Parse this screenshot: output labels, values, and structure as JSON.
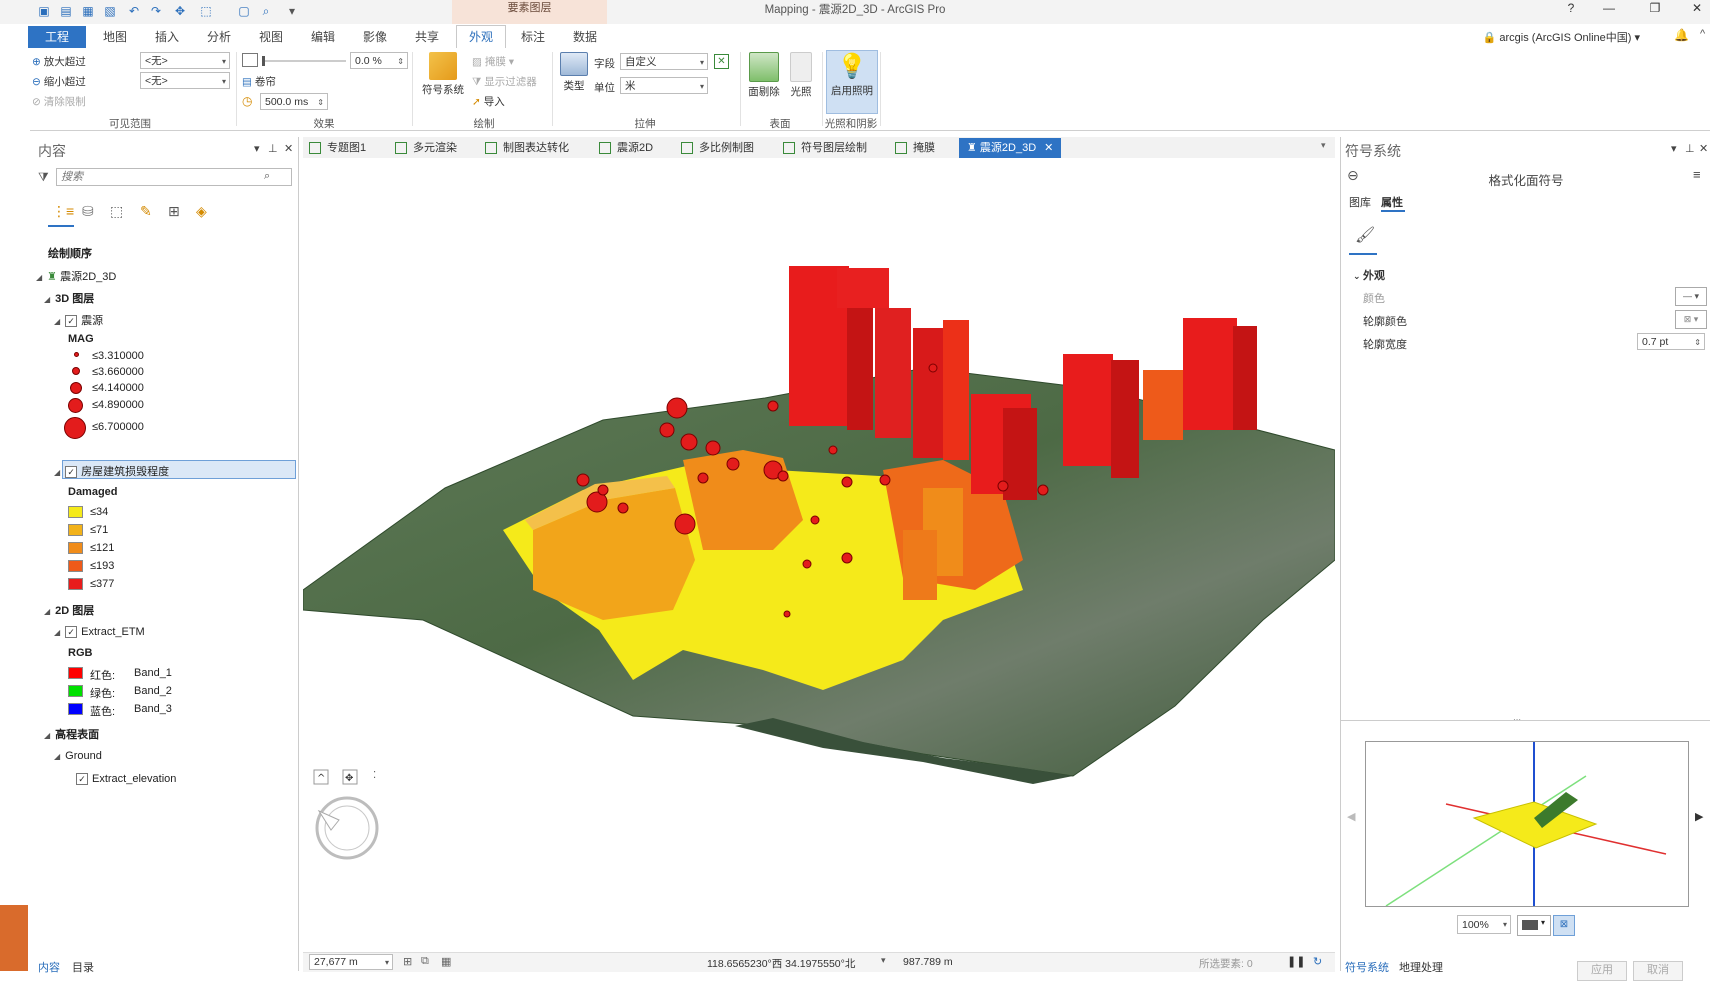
{
  "title_bar": {
    "app_title": "Mapping - 震源2D_3D - ArcGIS Pro",
    "context_tab_group": "要素图层",
    "help": "?",
    "minimize": "—",
    "restore": "❐",
    "close": "✕"
  },
  "ribbon_tabs": [
    {
      "label": "工程"
    },
    {
      "label": "地图"
    },
    {
      "label": "插入"
    },
    {
      "label": "分析"
    },
    {
      "label": "视图"
    },
    {
      "label": "编辑"
    },
    {
      "label": "影像"
    },
    {
      "label": "共享"
    },
    {
      "label": "外观"
    },
    {
      "label": "标注"
    },
    {
      "label": "数据"
    }
  ],
  "account": {
    "label": "arcgis (ArcGIS Online中国) ▾",
    "bell": "🔔",
    "collapse": "^"
  },
  "ribbon": {
    "visible_range": {
      "zoom_in_beyond": "放大超过",
      "zoom_out_beyond": "缩小超过",
      "clear_limits": "清除限制",
      "zoom_in_value": "<无>",
      "zoom_out_value": "<无>",
      "group_label": "可见范围"
    },
    "effects": {
      "transparency_value": "0.0 %",
      "swipe": "卷帘",
      "flicker_value": "500.0  ms",
      "group_label": "效果"
    },
    "drawing": {
      "symbology": "符号系统",
      "mask": "掩膜",
      "display_filters": "显示过滤器",
      "import": "导入",
      "group_label": "绘制"
    },
    "extrusion": {
      "type": "类型",
      "field_label": "字段",
      "field_value": "自定义",
      "unit_label": "单位",
      "unit_value": "米",
      "group_label": "拉伸"
    },
    "faces": {
      "face_culling": "面剔除",
      "lighting": "光照",
      "group_label": "表面"
    },
    "illumination": {
      "enable_lighting": "启用照明",
      "group_label": "光照和阴影"
    }
  },
  "contents_pane": {
    "title": "内容",
    "search_placeholder": "搜索",
    "drawing_order": "绘制顺序",
    "map_name": "震源2D_3D",
    "layer_3d": "3D 图层",
    "epicenter_layer": "震源",
    "mag_field": "MAG",
    "mag_classes": [
      "≤3.310000",
      "≤3.660000",
      "≤4.140000",
      "≤4.890000",
      "≤6.700000"
    ],
    "damage_layer": "房屋建筑损毁程度",
    "damaged_field": "Damaged",
    "damaged_classes": [
      "≤34",
      "≤71",
      "≤121",
      "≤193",
      "≤377"
    ],
    "damaged_colors": [
      "#f5ea1a",
      "#f2b21a",
      "#f08c1a",
      "#ee5a1a",
      "#e81c1c"
    ],
    "layer_2d": "2D 图层",
    "etm_layer": "Extract_ETM",
    "rgb": "RGB",
    "bands": [
      {
        "channel": "红色:",
        "band": "Band_1",
        "color": "#ff0000"
      },
      {
        "channel": "绿色:",
        "band": "Band_2",
        "color": "#00e000"
      },
      {
        "channel": "蓝色:",
        "band": "Band_3",
        "color": "#0000ff"
      }
    ],
    "elevation_surface": "高程表面",
    "ground": "Ground",
    "elevation_layer": "Extract_elevation",
    "bottom_tabs": [
      "内容",
      "目录"
    ]
  },
  "view_tabs": [
    {
      "label": "专题图1"
    },
    {
      "label": "多元渲染"
    },
    {
      "label": "制图表达转化"
    },
    {
      "label": "震源2D"
    },
    {
      "label": "多比例制图"
    },
    {
      "label": "符号图层绘制"
    },
    {
      "label": "掩膜"
    },
    {
      "label": "震源2D_3D"
    }
  ],
  "status_bar": {
    "scale": "27,677 m",
    "coords": "118.6565230°西 34.1975550°北",
    "elevation": "987.789 m",
    "selected": "所选要素: 0"
  },
  "symbology_pane": {
    "title": "符号系统",
    "header": "格式化面符号",
    "tab_gallery": "图库",
    "tab_properties": "属性",
    "section_appearance": "外观",
    "color_label": "颜色",
    "outline_color_label": "轮廓颜色",
    "outline_width_label": "轮廓宽度",
    "outline_width_value": "0.7 pt",
    "preview_zoom": "100%",
    "apply": "应用",
    "cancel": "取消",
    "bottom_tabs": [
      "符号系统",
      "地理处理"
    ]
  }
}
